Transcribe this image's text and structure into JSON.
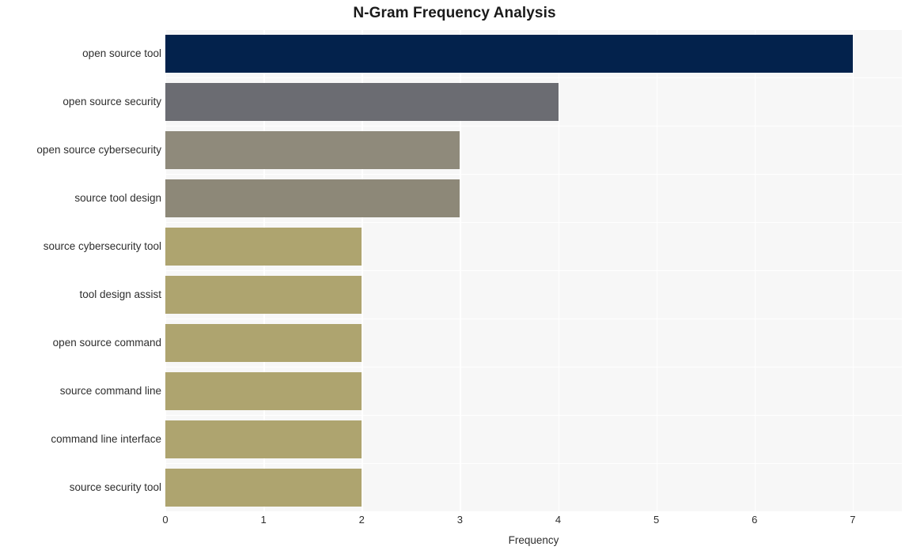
{
  "chart_data": {
    "type": "bar",
    "orientation": "horizontal",
    "title": "N-Gram Frequency Analysis",
    "xlabel": "Frequency",
    "ylabel": "",
    "categories": [
      "open source tool",
      "open source security",
      "open source cybersecurity",
      "source tool design",
      "source cybersecurity tool",
      "tool design assist",
      "open source command",
      "source command line",
      "command line interface",
      "source security tool"
    ],
    "values": [
      7,
      4,
      3,
      3,
      2,
      2,
      2,
      2,
      2,
      2
    ],
    "bar_colors": [
      "#03224c",
      "#6b6c72",
      "#8f8a7b",
      "#8d8878",
      "#aea46f",
      "#aea46f",
      "#aea46f",
      "#aea46f",
      "#aea46f",
      "#aea46f"
    ],
    "xlim": [
      0,
      7.5
    ],
    "xticks": [
      0,
      1,
      2,
      3,
      4,
      5,
      6,
      7
    ],
    "xticklabels": [
      "0",
      "1",
      "2",
      "3",
      "4",
      "5",
      "6",
      "7"
    ],
    "grid": true,
    "grid_color": "#ffffff",
    "plot_background": "#f7f7f7",
    "figure_background": "#ffffff",
    "legend": null
  }
}
